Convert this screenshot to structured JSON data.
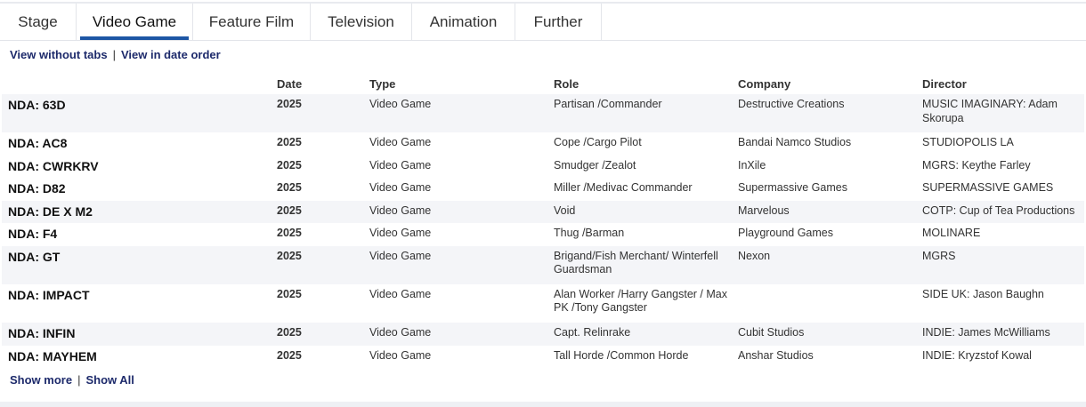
{
  "tabs": [
    "Stage",
    "Video Game",
    "Feature Film",
    "Television",
    "Animation",
    "Further"
  ],
  "active_tab": "Video Game",
  "top_links": {
    "without_tabs": "View without tabs",
    "separator": "|",
    "date_order": "View in date order"
  },
  "columns": {
    "date": "Date",
    "type": "Type",
    "role": "Role",
    "company": "Company",
    "director": "Director"
  },
  "rows": [
    {
      "title": "NDA: 63D",
      "date": "2025",
      "type": "Video Game",
      "role": "Partisan /Commander",
      "company": "Destructive Creations",
      "director": "MUSIC IMAGINARY: Adam Skorupa"
    },
    {
      "title": "NDA: AC8",
      "date": "2025",
      "type": "Video Game",
      "role": "Cope /Cargo Pilot",
      "company": "Bandai Namco Studios",
      "director": "STUDIOPOLIS LA"
    },
    {
      "title": "NDA: CWRKRV",
      "date": "2025",
      "type": "Video Game",
      "role": "Smudger /Zealot",
      "company": "InXile",
      "director": "MGRS: Keythe Farley"
    },
    {
      "title": "NDA: D82",
      "date": "2025",
      "type": "Video Game",
      "role": "Miller /Medivac Commander",
      "company": "Supermassive Games",
      "director": "SUPERMASSIVE GAMES"
    },
    {
      "title": "NDA: DE X M2",
      "date": "2025",
      "type": "Video Game",
      "role": "Void",
      "company": "Marvelous",
      "director": "COTP: Cup of Tea Productions"
    },
    {
      "title": "NDA: F4",
      "date": "2025",
      "type": "Video Game",
      "role": "Thug /Barman",
      "company": "Playground Games",
      "director": "MOLINARE"
    },
    {
      "title": "NDA: GT",
      "date": "2025",
      "type": "Video Game",
      "role": "Brigand/Fish Merchant/ Winterfell Guardsman",
      "company": "Nexon",
      "director": "MGRS"
    },
    {
      "title": "NDA: IMPACT",
      "date": "2025",
      "type": "Video Game",
      "role": "Alan Worker /Harry Gangster / Max PK /Tony Gangster",
      "company": "",
      "director": "SIDE UK: Jason Baughn"
    },
    {
      "title": "NDA: INFIN",
      "date": "2025",
      "type": "Video Game",
      "role": "Capt. Relinrake",
      "company": "Cubit Studios",
      "director": "INDIE: James McWilliams"
    },
    {
      "title": "NDA: MAYHEM",
      "date": "2025",
      "type": "Video Game",
      "role": "Tall Horde /Common Horde",
      "company": "Anshar Studios",
      "director": "INDIE: Kryzstof Kowal"
    }
  ],
  "bottom_links": {
    "show_more": "Show more",
    "separator": "|",
    "show_all": "Show All"
  },
  "colors": {
    "accent": "#1d56a5",
    "link": "#1d2a6b",
    "row_shade": "#f4f5f8"
  }
}
